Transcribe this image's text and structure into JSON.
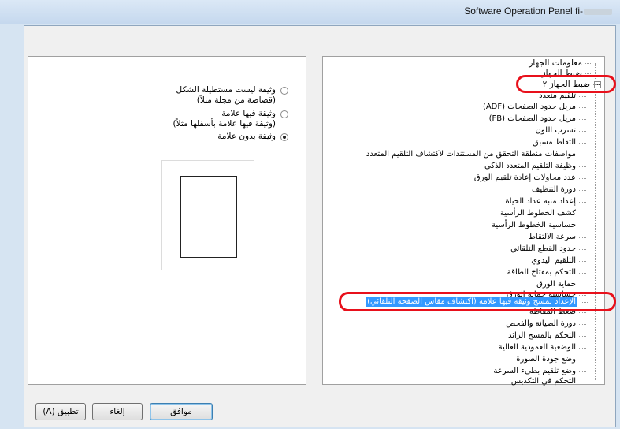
{
  "window": {
    "title": "Software Operation Panel fi-"
  },
  "options": [
    {
      "label": "وثيقة ليست مستطيلة الشكل",
      "sub": "(قصاصة من مجلة مثلاً)",
      "checked": false
    },
    {
      "label": "وثيقة فيها علامة",
      "sub": "(وثيقة فيها علامة بأسفلها مثلاً)",
      "checked": false
    },
    {
      "label": "وثيقة بدون علامة",
      "sub": "",
      "checked": true
    }
  ],
  "tree": {
    "items": [
      "معلومات الجهاز",
      "ضبط الجهاز",
      "ضبط الجهاز ٢",
      "تلقيم متعدد",
      "مزيل حدود الصفحات (ADF)",
      "مزيل حدود الصفحات (FB)",
      "تسرب اللون",
      "التقاط مسبق",
      "مواصفات منطقة التحقق من المستندات لاكتشاف التلقيم المتعدد",
      "وظيفة التلقيم المتعدد الذكي",
      "عدد محاولات إعادة تلقيم الورق",
      "دورة التنظيف",
      "إعداد منبه عداد الحياة",
      "كشف الخطوط الرأسية",
      "حساسية الخطوط الرأسية",
      "سرعة الالتقاط",
      "حدود القطع التلقائي",
      "التلقيم اليدوي",
      "التحكم بمفتاح الطاقة",
      "حماية الورق",
      "حساسية حماية الورق",
      "الإعداد لمسح وثيقة فيها علامة (اكتشاف مقاس الصفحة التلقائي)",
      "ضغط المقاطة",
      "دورة الصيانة والفحص",
      "التحكم بالمسح الزائد",
      "الوضعية العمودية العالية",
      "وضع جودة الصورة",
      "وضع تلقيم بطيء السرعة",
      "التحكم في التكديس"
    ]
  },
  "buttons": {
    "ok": "موافق",
    "cancel": "إلغاء",
    "apply": "تطبيق (A)"
  },
  "colors": {
    "selection": "#3399ff",
    "callout": "#e8101b"
  }
}
